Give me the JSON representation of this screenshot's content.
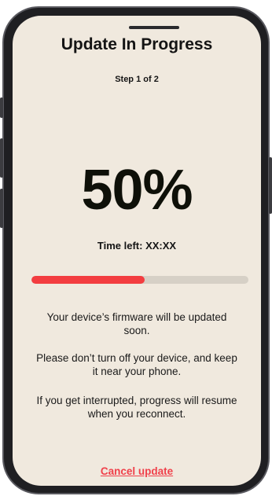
{
  "update": {
    "title": "Update In Progress",
    "step": "Step 1 of 2",
    "percent": "50%",
    "progress_fraction": 0.52,
    "time_left": "Time left: XX:XX",
    "messages": [
      "Your device’s firmware will be updated soon.",
      "Please don’t turn off your device, and keep it near your phone.",
      "If you get interrupted, progress will resume when you reconnect."
    ],
    "cancel_label": "Cancel update"
  },
  "colors": {
    "screen_bg": "#f0e9de",
    "progress_fill": "#f33d40",
    "progress_track": "#d6d0c6",
    "cancel_link": "#f0404a"
  }
}
